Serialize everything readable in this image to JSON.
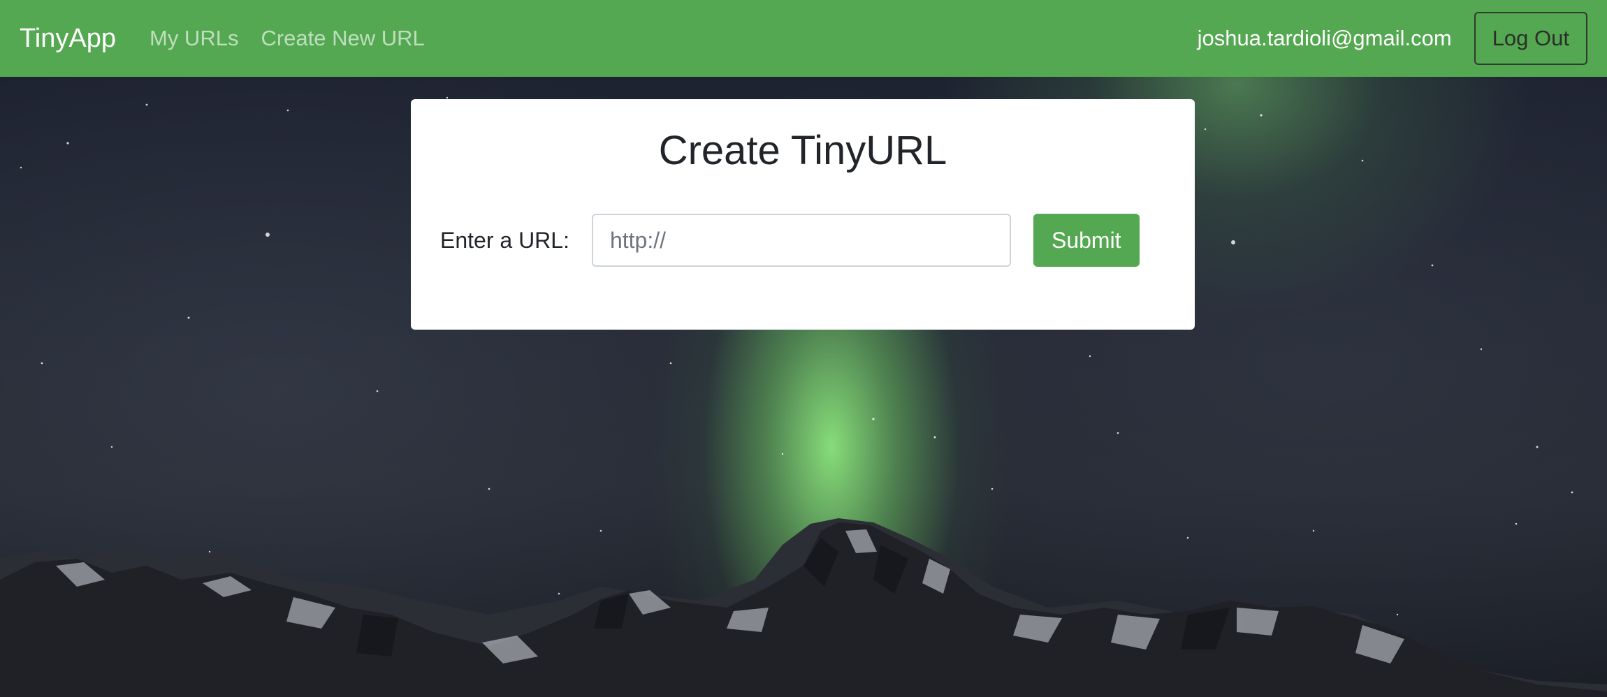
{
  "navbar": {
    "brand": "TinyApp",
    "links": [
      {
        "label": "My URLs"
      },
      {
        "label": "Create New URL"
      }
    ],
    "user_email": "joshua.tardioli@gmail.com",
    "logout_label": "Log Out",
    "background_color": "#54a851"
  },
  "card": {
    "title": "Create TinyURL",
    "url_label": "Enter a URL:",
    "url_input": {
      "value": "",
      "placeholder": "http://"
    },
    "submit_label": "Submit"
  },
  "background": {
    "description_icon": "aurora-mountain-background"
  }
}
